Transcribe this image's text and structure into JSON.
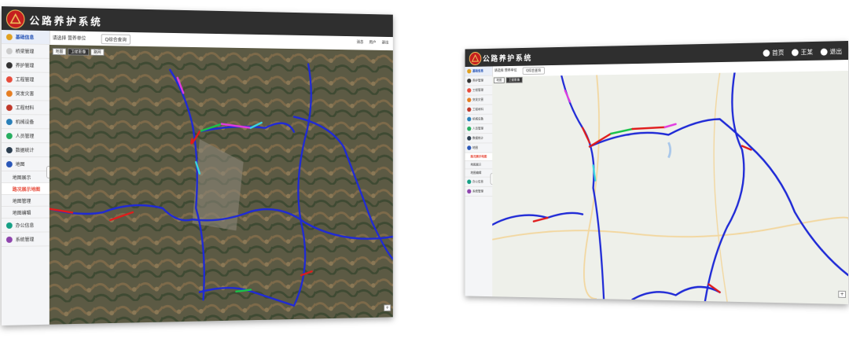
{
  "app": {
    "title": "公路养护系统"
  },
  "left_window": {
    "sidebar": {
      "items": [
        {
          "label": "基础信息",
          "icon": "home-icon",
          "color": "#e0a020",
          "active": true
        },
        {
          "label": "桥梁管理",
          "icon": "",
          "color": "#cccccc"
        },
        {
          "label": "养护管理",
          "icon": "wrench-icon",
          "color": "#333333"
        },
        {
          "label": "工程管理",
          "icon": "gear-icon",
          "color": "#e74c3c"
        },
        {
          "label": "突发灾害",
          "icon": "alert-icon",
          "color": "#e67e22"
        },
        {
          "label": "工程材料",
          "icon": "box-icon",
          "color": "#c0392b"
        },
        {
          "label": "机械设备",
          "icon": "truck-icon",
          "color": "#2980b9"
        },
        {
          "label": "人员管理",
          "icon": "user-icon",
          "color": "#27ae60"
        },
        {
          "label": "数据统计",
          "icon": "chart-icon",
          "color": "#2c3e50"
        },
        {
          "label": "地图",
          "icon": "map-icon",
          "color": "#2a57b8",
          "open": true
        },
        {
          "label": "地图展示",
          "sub": true
        },
        {
          "label": "路况展示地图",
          "sub": true,
          "active": true
        },
        {
          "label": "地图管理",
          "sub": true
        },
        {
          "label": "地图编辑",
          "sub": true
        },
        {
          "label": "办公信息",
          "icon": "briefcase-icon",
          "color": "#16a085"
        },
        {
          "label": "系统管理",
          "icon": "settings-icon",
          "color": "#8e44ad"
        }
      ]
    },
    "header": {
      "unit_select": "请选择 营养单位",
      "search_placeholder": "Q综合查询",
      "right": [
        "消息",
        "用户",
        "退出"
      ]
    },
    "map_buttons": [
      "地图",
      "卫星影像",
      "路网"
    ]
  },
  "right_window": {
    "toolbar": {
      "home": "首页",
      "user": "王某",
      "logout": "退出"
    },
    "header": {
      "unit_select": "请选择 营养单位",
      "search_placeholder": "Q综合查询"
    },
    "map_buttons": [
      "地图",
      "卫星影像"
    ],
    "sidebar": {
      "items": [
        {
          "label": "基础信息",
          "color": "#e0a020",
          "active": true
        },
        {
          "label": "养护管理",
          "color": "#333333"
        },
        {
          "label": "工程管理",
          "color": "#e74c3c"
        },
        {
          "label": "突发灾害",
          "color": "#e67e22"
        },
        {
          "label": "工程材料",
          "color": "#c0392b"
        },
        {
          "label": "机械设备",
          "color": "#2980b9"
        },
        {
          "label": "人员管理",
          "color": "#27ae60"
        },
        {
          "label": "数据统计",
          "color": "#2c3e50"
        },
        {
          "label": "地图",
          "color": "#2a57b8",
          "open": true
        },
        {
          "label": "路况展示地图",
          "sub": true,
          "active": true
        },
        {
          "label": "地图展示",
          "sub": true
        },
        {
          "label": "地图编辑",
          "sub": true
        },
        {
          "label": "办公信息",
          "color": "#16a085"
        },
        {
          "label": "系统管理",
          "color": "#8e44ad"
        }
      ]
    }
  },
  "colors": {
    "topbar": "#2f2f2f",
    "road_good": "#1f2ad6",
    "road_bad": "#e01b1b",
    "road_fair": "#19c24a",
    "road_warn": "#e23be0",
    "road_mid": "#3ad6e0"
  }
}
